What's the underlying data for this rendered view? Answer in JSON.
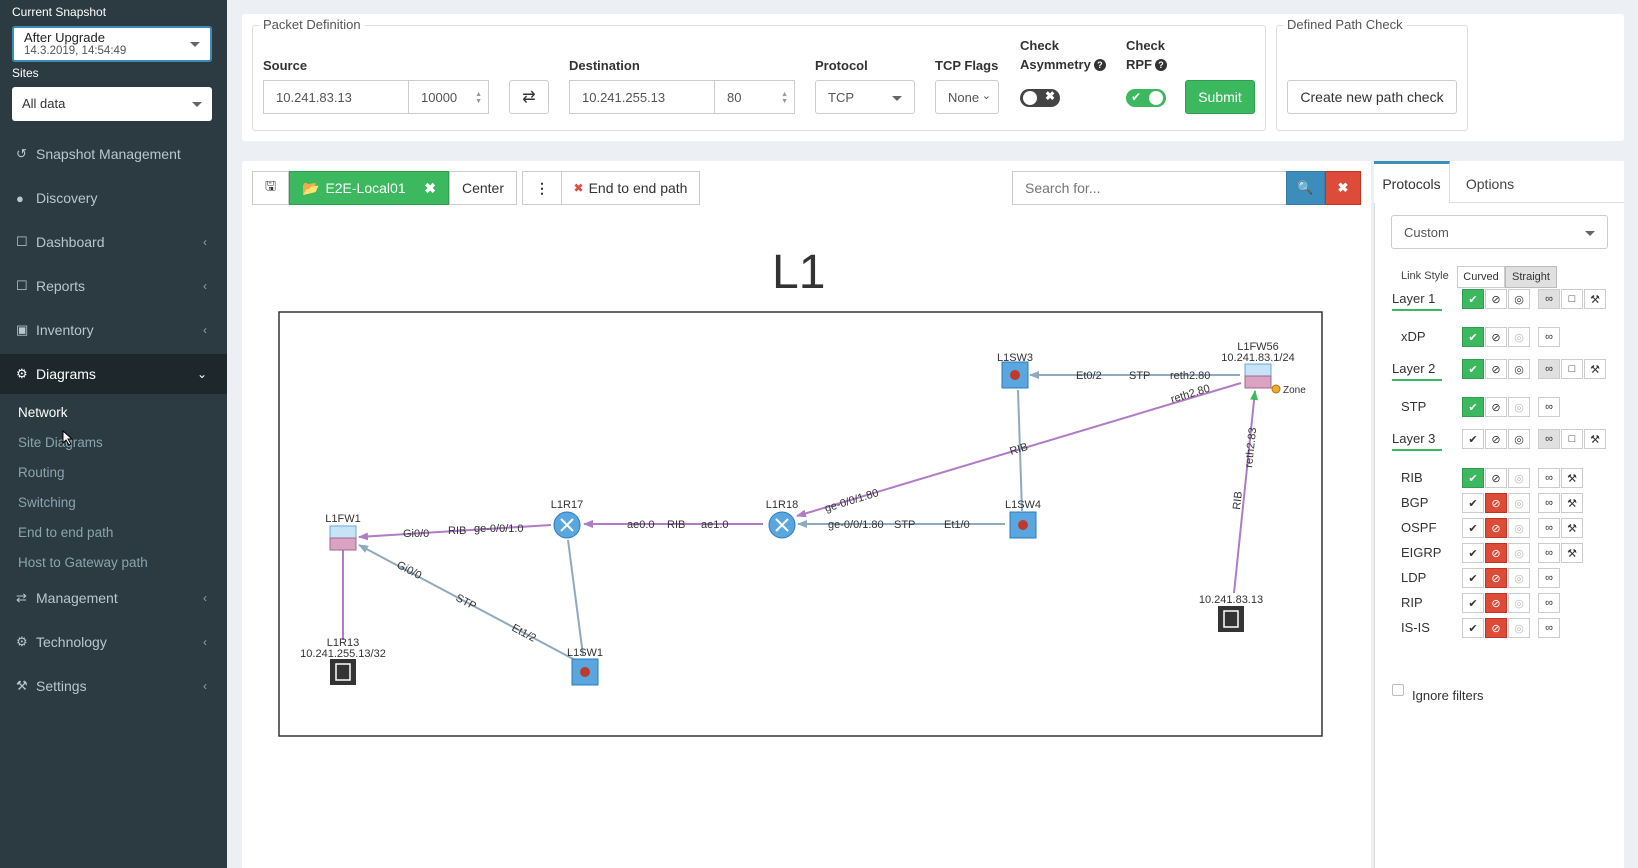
{
  "sidebar": {
    "snapshot_label": "Current Snapshot",
    "snapshot_name": "After Upgrade",
    "snapshot_date": "14.3.2019, 14:54:49",
    "sites_label": "Sites",
    "sites_value": "All data",
    "menu": [
      {
        "label": "Snapshot Management",
        "icon": "history-icon"
      },
      {
        "label": "Discovery",
        "icon": "globe-icon"
      },
      {
        "label": "Dashboard",
        "icon": "file-icon"
      },
      {
        "label": "Reports",
        "icon": "file-icon"
      },
      {
        "label": "Inventory",
        "icon": "archive-icon"
      },
      {
        "label": "Diagrams",
        "icon": "cogs-icon"
      },
      {
        "label": "Management",
        "icon": "exchange-icon"
      },
      {
        "label": "Technology",
        "icon": "gear-icon"
      },
      {
        "label": "Settings",
        "icon": "wrench-icon"
      }
    ],
    "diagrams_sub": [
      "Network",
      "Site Diagrams",
      "Routing",
      "Switching",
      "End to end path",
      "Host to Gateway path"
    ]
  },
  "packet": {
    "legend": "Packet Definition",
    "source_label": "Source",
    "source_ip": "10.241.83.13",
    "source_port": "10000",
    "dest_label": "Destination",
    "dest_ip": "10.241.255.13",
    "dest_port": "80",
    "protocol_label": "Protocol",
    "protocol_value": "TCP",
    "tcpflags_label": "TCP Flags",
    "tcpflags_value": "None",
    "check_asym_line1": "Check",
    "check_asym_line2": "Asymmetry",
    "check_rpf_line1": "Check",
    "check_rpf_line2": "RPF",
    "submit_label": "Submit"
  },
  "path_check": {
    "legend": "Defined Path Check",
    "create_label": "Create new path check"
  },
  "toolbar": {
    "tab_label": "E2E-Local01",
    "center_label": "Center",
    "e2e_label": "End to end path",
    "search_placeholder": "Search for..."
  },
  "diagram": {
    "title": "L1",
    "nodes": {
      "l1fw1": "L1FW1",
      "l1r17": "L1R17",
      "l1r18": "L1R18",
      "l1sw4": "L1SW4",
      "l1sw3": "L1SW3",
      "l1fw56": "L1FW56",
      "l1fw56_ip": "10.241.83.1/24",
      "zone": "Zone",
      "l1r13": "L1R13",
      "l1r13_ip": "10.241.255.13/32",
      "l1sw1": "L1SW1",
      "host": "10.241.83.13"
    },
    "edge_labels": {
      "fw1_r17_a": "Gi0/0",
      "fw1_r17_b": "RIB",
      "fw1_r17_c": "ge-0/0/1.0",
      "r17_r18_a": "ae0.0",
      "r17_r18_b": "RIB",
      "r17_r18_c": "ae1.0",
      "r18_sw4_a": "ge-0/0/1.80",
      "r18_sw4_b": "STP",
      "r18_sw4_c": "Et1/0",
      "sw3_fw56_a": "Et0/2",
      "sw3_fw56_b": "STP",
      "sw3_fw56_c": "reth2.80",
      "fw56_r18_a": "reth2.80",
      "fw56_r18_b": "RIB",
      "fw56_r18_c": "ge-0/0/1.80",
      "host_fw56_a": "RIB",
      "host_fw56_b": "reth2.83",
      "fw1_sw1_a": "Gi0/0",
      "fw1_sw1_b": "STP",
      "fw1_sw1_c": "Et1/2"
    }
  },
  "right_panel": {
    "tab_protocols": "Protocols",
    "tab_options": "Options",
    "preset": "Custom",
    "link_style_label": "Link Style",
    "curved": "Curved",
    "straight": "Straight",
    "rows": [
      "Layer 1",
      "xDP",
      "Layer 2",
      "STP",
      "Layer 3",
      "RIB",
      "BGP",
      "OSPF",
      "EIGRP",
      "LDP",
      "RIP",
      "IS-IS"
    ],
    "ignore_filters": "Ignore filters"
  },
  "colors": {
    "sidebar_bg": "#2c3b41",
    "green": "#3cb85f",
    "red": "#dd4b39",
    "blue": "#3c8dbc",
    "rib_edge": "#b07cc6",
    "stp_edge": "#8fa9bf"
  }
}
